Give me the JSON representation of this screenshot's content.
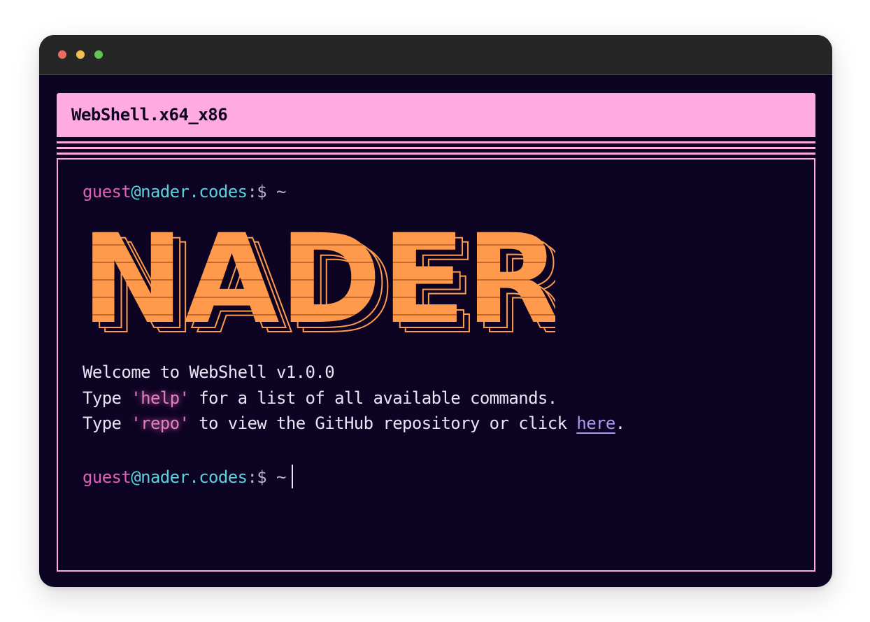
{
  "terminal": {
    "title": "WebShell.x64_x86"
  },
  "prompt": {
    "user": "guest",
    "at": "@",
    "host": "nader.codes",
    "suffix": ":$ ~"
  },
  "banner": {
    "text": "NADER",
    "color": "#ff9a4d"
  },
  "welcome": {
    "line1": "Welcome to WebShell v1.0.0",
    "line2_pre": "Type ",
    "line2_cmd": "'help'",
    "line2_post": " for a list of all available commands.",
    "line3_pre": "Type ",
    "line3_cmd": "'repo'",
    "line3_mid": " to view the GitHub repository or click ",
    "line3_link": "here",
    "line3_end": "."
  },
  "colors": {
    "background": "#0c0422",
    "accent_pink": "#ffaae3",
    "user": "#e060b8",
    "host": "#5ed0dc",
    "link": "#a99af0"
  }
}
